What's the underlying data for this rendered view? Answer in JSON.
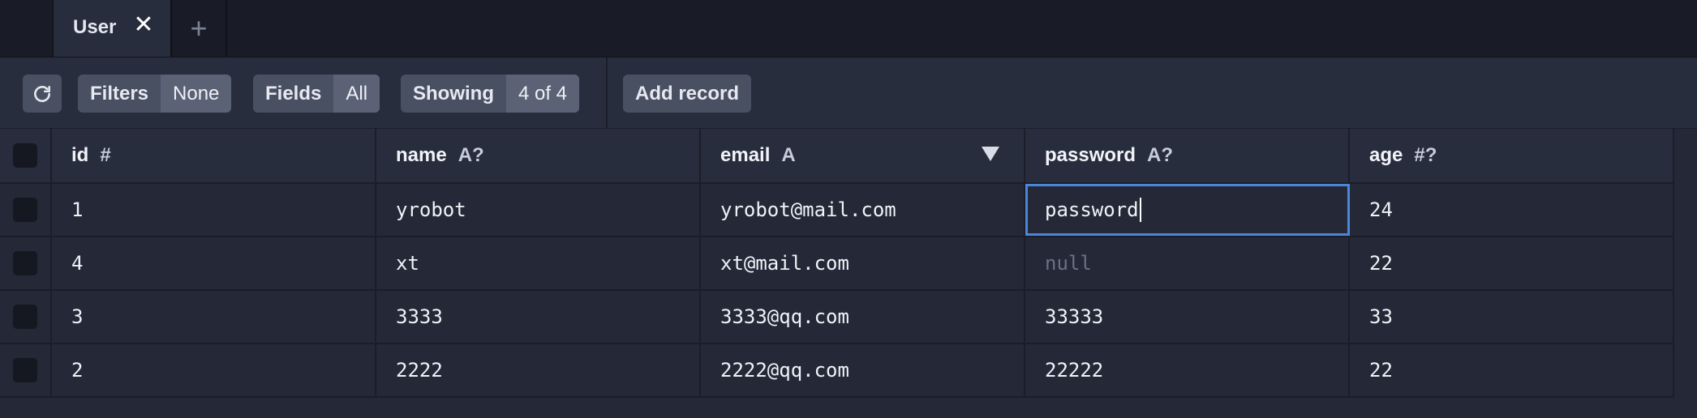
{
  "tabs": [
    {
      "label": "User",
      "close_icon": "close-icon"
    }
  ],
  "tab_add_label": "+",
  "toolbar": {
    "refresh_icon": "refresh-icon",
    "filters": {
      "label": "Filters",
      "value": "None"
    },
    "fields": {
      "label": "Fields",
      "value": "All"
    },
    "showing": {
      "label": "Showing",
      "value": "4 of 4"
    },
    "add_record_label": "Add record"
  },
  "table": {
    "columns": [
      {
        "name": "id",
        "type": "#"
      },
      {
        "name": "name",
        "type": "A?"
      },
      {
        "name": "email",
        "type": "A",
        "sorted": "descending"
      },
      {
        "name": "password",
        "type": "A?"
      },
      {
        "name": "age",
        "type": "#?"
      }
    ],
    "rows": [
      {
        "id": "1",
        "name": "yrobot",
        "email": "yrobot@mail.com",
        "password": "password",
        "age": "24"
      },
      {
        "id": "4",
        "name": "xt",
        "email": "xt@mail.com",
        "password": "null",
        "age": "22"
      },
      {
        "id": "3",
        "name": "3333",
        "email": "3333@qq.com",
        "password": "33333",
        "age": "33"
      },
      {
        "id": "2",
        "name": "2222",
        "email": "2222@qq.com",
        "password": "22222",
        "age": "22"
      }
    ]
  },
  "colors": {
    "background": "#242837",
    "tabbar": "#191c26",
    "accent_focus": "#4a86d9",
    "button": "#495062"
  }
}
